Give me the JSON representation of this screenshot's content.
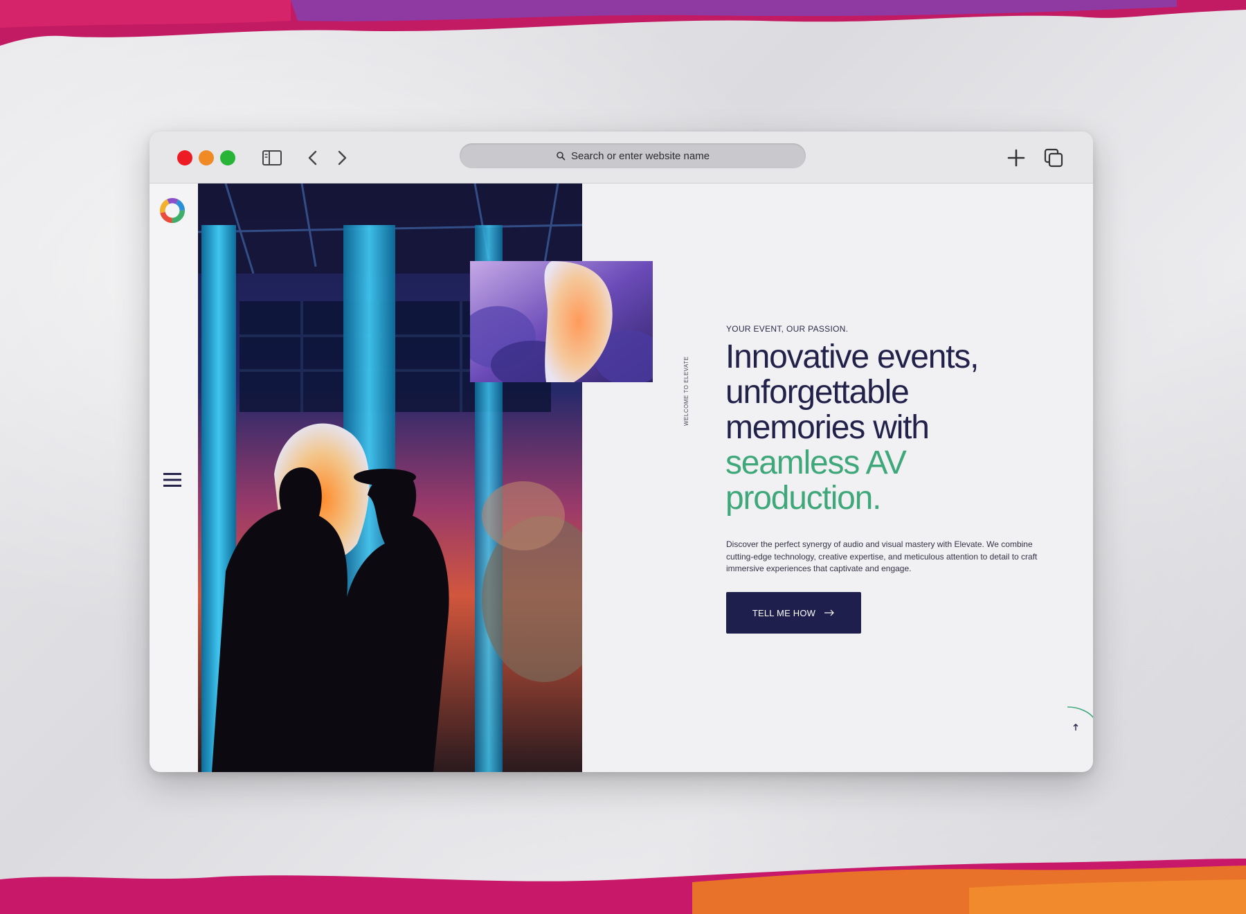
{
  "browser": {
    "address_placeholder": "Search or enter website name"
  },
  "hero": {
    "vertical_label": "WELCOME TO ELEVATE",
    "eyebrow": "YOUR EVENT, OUR PASSION.",
    "headline_lines": [
      "Innovative events,",
      "unforgettable",
      "memories with"
    ],
    "headline_accent_lines": [
      "seamless AV",
      "production."
    ],
    "description": "Discover the perfect synergy of audio and visual mastery with Elevate. We combine cutting-edge technology, creative expertise, and meticulous attention to detail to craft immersive experiences that captivate and engage.",
    "cta_label": "TELL ME HOW"
  },
  "colors": {
    "navy": "#22214a",
    "accent_green": "#3fa87a",
    "cta_bg": "#1f1f4e"
  },
  "icons": [
    "sidebar-toggle-icon",
    "back-arrow-icon",
    "forward-arrow-icon",
    "search-icon",
    "plus-icon",
    "tabs-icon",
    "logo-icon",
    "hamburger-menu-icon",
    "arrow-right-icon",
    "arrow-up-icon"
  ]
}
